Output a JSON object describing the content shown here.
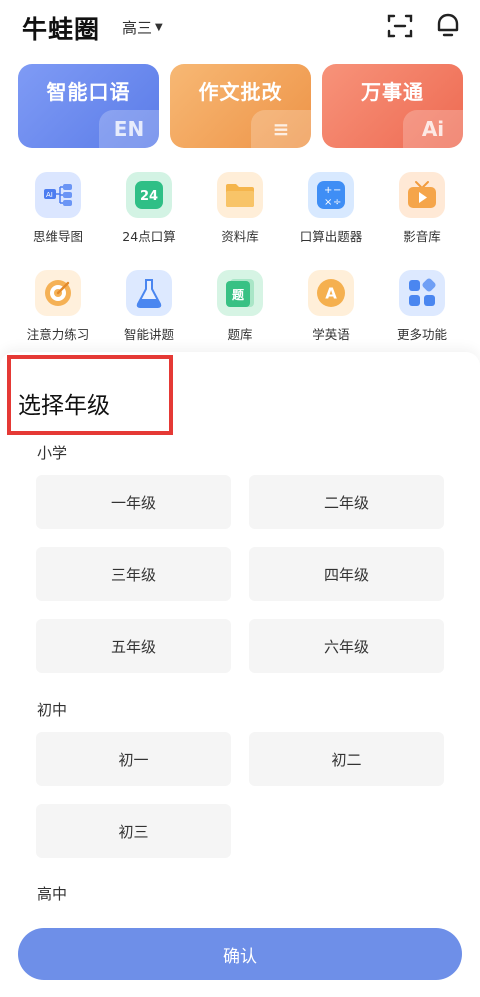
{
  "header": {
    "app_title": "牛蛙圈",
    "grade": "高三"
  },
  "feature_cards": [
    {
      "label": "智能口语",
      "tag": "EN",
      "color": "#6b8df0"
    },
    {
      "label": "作文批改",
      "tag": "≡",
      "color": "#f2a35a"
    },
    {
      "label": "万事通",
      "tag": "Ai",
      "color": "#f07c63"
    }
  ],
  "tools": [
    {
      "label": "思维导图",
      "icon": "mind-map-icon"
    },
    {
      "label": "24点口算",
      "icon": "24-points-icon"
    },
    {
      "label": "资料库",
      "icon": "folder-icon"
    },
    {
      "label": "口算出题器",
      "icon": "calculator-icon"
    },
    {
      "label": "影音库",
      "icon": "tv-icon"
    },
    {
      "label": "注意力练习",
      "icon": "target-icon"
    },
    {
      "label": "智能讲题",
      "icon": "flask-icon"
    },
    {
      "label": "题库",
      "icon": "question-bank-icon"
    },
    {
      "label": "学英语",
      "icon": "english-icon"
    },
    {
      "label": "更多功能",
      "icon": "more-apps-icon"
    }
  ],
  "sheet": {
    "title": "选择年级",
    "sections": {
      "primary": {
        "label": "小学",
        "grades": [
          "一年级",
          "二年级",
          "三年级",
          "四年级",
          "五年级",
          "六年级"
        ]
      },
      "junior": {
        "label": "初中",
        "grades": [
          "初一",
          "初二",
          "初三"
        ]
      },
      "senior": {
        "label": "高中"
      }
    },
    "confirm": "确认"
  }
}
